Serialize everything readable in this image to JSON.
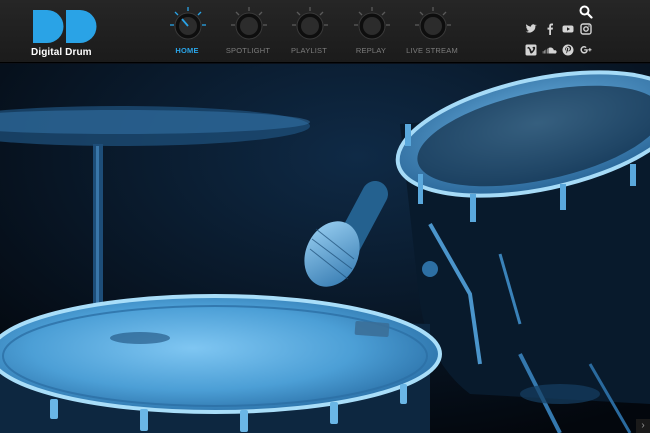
{
  "brand": {
    "name": "Digital Drum",
    "accent": "#2aa3e6"
  },
  "nav": {
    "items": [
      {
        "label": "HOME",
        "active": true
      },
      {
        "label": "SPOTLIGHT",
        "active": false
      },
      {
        "label": "PLAYLIST",
        "active": false
      },
      {
        "label": "REPLAY",
        "active": false
      },
      {
        "label": "LIVE STREAM",
        "active": false
      }
    ]
  },
  "social": {
    "icons": [
      "twitter-icon",
      "facebook-icon",
      "youtube-icon",
      "instagram-icon",
      "vimeo-icon",
      "soundcloud-icon",
      "pinterest-icon",
      "google-plus-icon"
    ]
  },
  "search": {
    "icon": "search-icon"
  },
  "hero": {
    "tint": "#2d7fc0",
    "corner_icon": "chevron-icon"
  }
}
